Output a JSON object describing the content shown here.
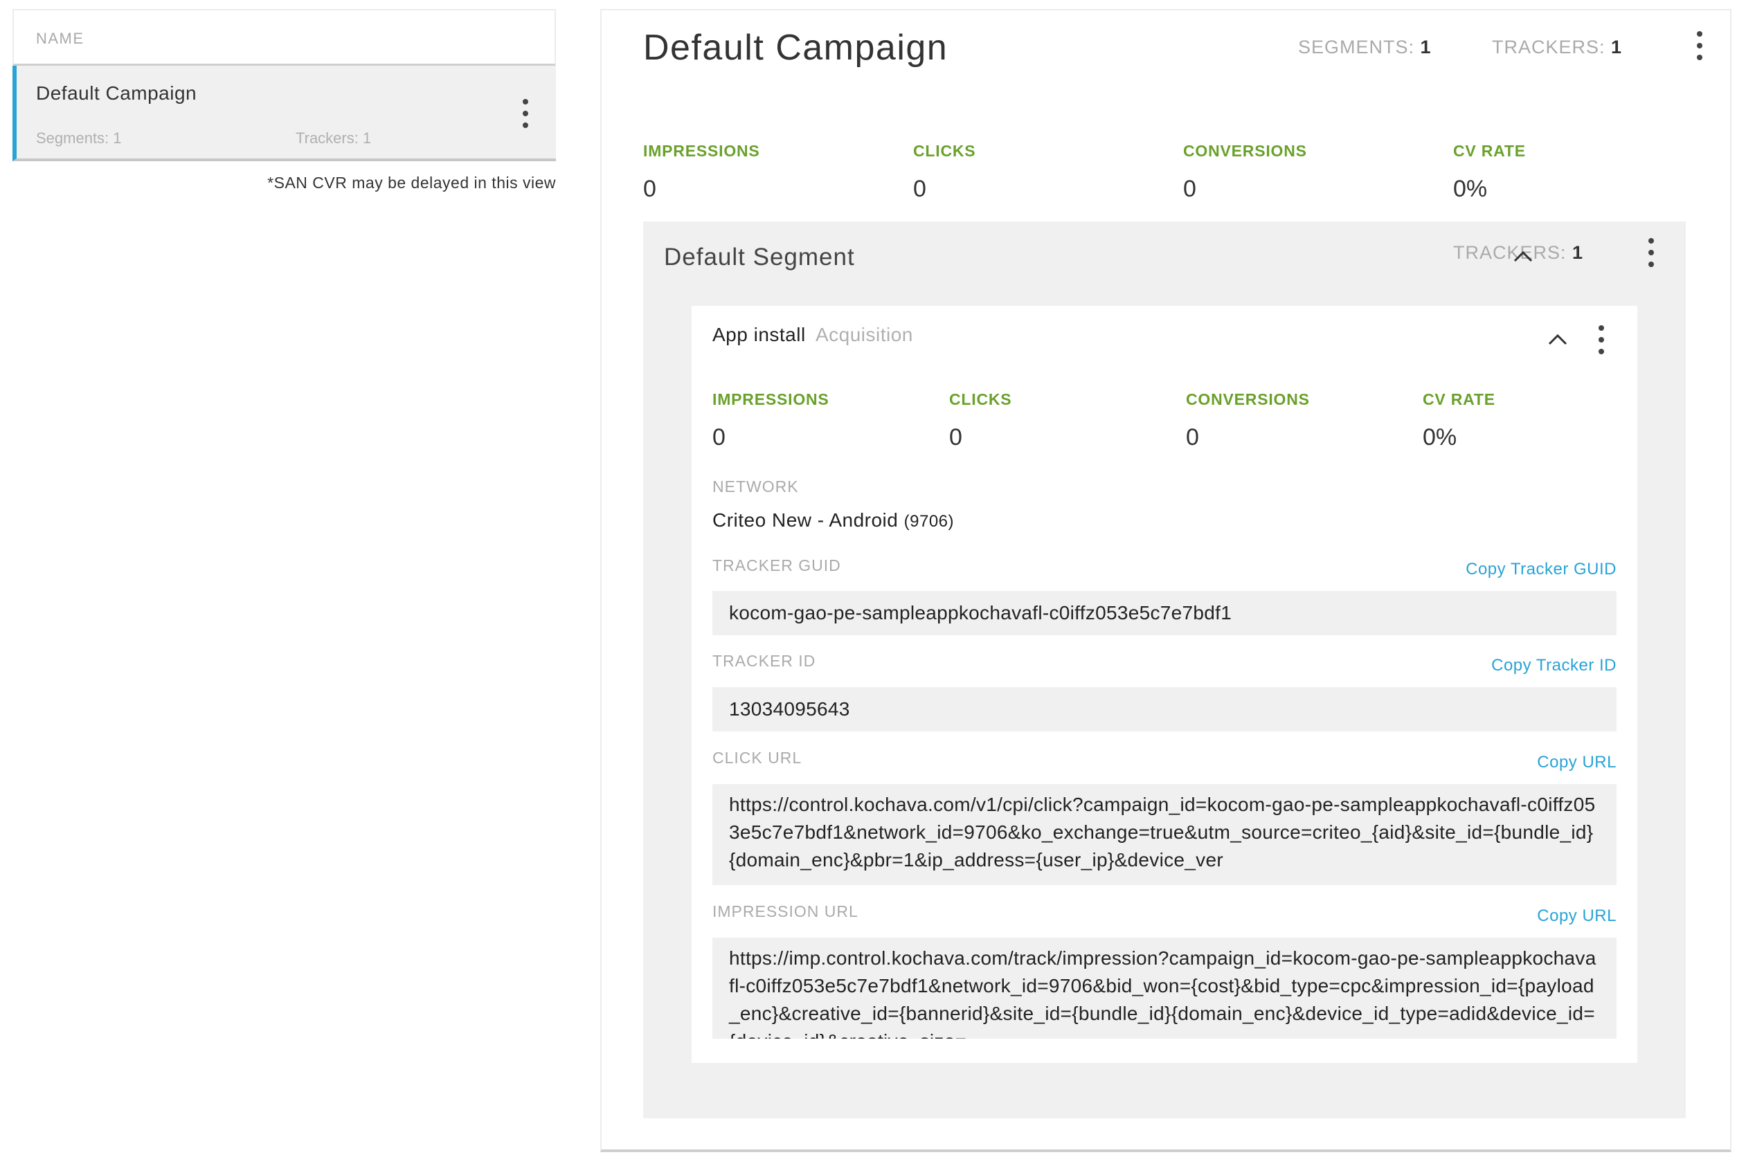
{
  "list": {
    "header": "NAME",
    "items": [
      {
        "name": "Default Campaign",
        "segments": "Segments: 1",
        "trackers": "Trackers: 1"
      }
    ],
    "note": "*SAN CVR may be delayed in this view"
  },
  "campaign": {
    "title": "Default Campaign",
    "segments_label": "SEGMENTS:",
    "segments_value": "1",
    "trackers_label": "TRACKERS:",
    "trackers_value": "1",
    "metrics": {
      "impressions_label": "IMPRESSIONS",
      "impressions_value": "0",
      "clicks_label": "CLICKS",
      "clicks_value": "0",
      "conversions_label": "CONVERSIONS",
      "conversions_value": "0",
      "cv_rate_label": "CV RATE",
      "cv_rate_value": "0%"
    }
  },
  "segment": {
    "title": "Default Segment",
    "trackers_label": "TRACKERS:",
    "trackers_value": "1"
  },
  "tracker": {
    "type": "App install",
    "category": "Acquisition",
    "metrics": {
      "impressions_label": "IMPRESSIONS",
      "impressions_value": "0",
      "clicks_label": "CLICKS",
      "clicks_value": "0",
      "conversions_label": "CONVERSIONS",
      "conversions_value": "0",
      "cv_rate_label": "CV RATE",
      "cv_rate_value": "0%"
    },
    "network_label": "NETWORK",
    "network_name": "Criteo New - Android",
    "network_id": "(9706)",
    "guid_label": "TRACKER GUID",
    "guid_copy": "Copy Tracker GUID",
    "guid_value": "kocom-gao-pe-sampleappkochavafl-c0iffz053e5c7e7bdf1",
    "id_label": "TRACKER ID",
    "id_copy": "Copy Tracker ID",
    "id_value": "13034095643",
    "click_url_label": "CLICK URL",
    "click_url_copy": "Copy URL",
    "click_url_value": "https://control.kochava.com/v1/cpi/click?campaign_id=kocom-gao-pe-sampleappkochavafl-c0iffz053e5c7e7bdf1&network_id=9706&ko_exchange=true&utm_source=criteo_{aid}&site_id={bundle_id}{domain_enc}&pbr=1&ip_address={user_ip}&device_ver",
    "impression_url_label": "IMPRESSION URL",
    "impression_url_copy": "Copy URL",
    "impression_url_value": "https://imp.control.kochava.com/track/impression?campaign_id=kocom-gao-pe-sampleappkochavafl-c0iffz053e5c7e7bdf1&network_id=9706&bid_won={cost}&bid_type=cpc&impression_id={payload_enc}&creative_id={bannerid}&site_id={bundle_id}{domain_enc}&device_id_type=adid&device_id={device_id}&creative_size="
  },
  "icons": {
    "more": "more-vertical-icon",
    "collapse": "chevron-up-icon"
  },
  "colors": {
    "accent": "#29a3d6",
    "metric_label": "#6aa12b",
    "panel_bg": "#f0f0f0"
  }
}
